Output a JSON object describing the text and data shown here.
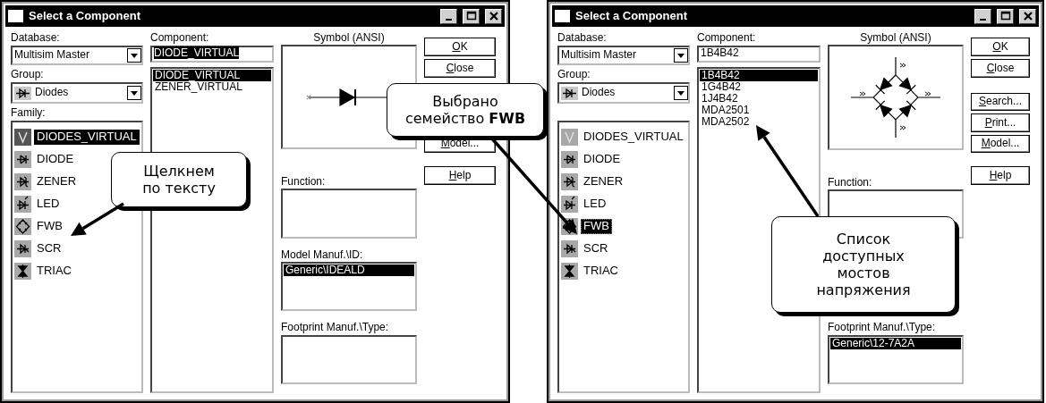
{
  "windows": [
    {
      "title": "Select a Component",
      "database": {
        "label": "Database:",
        "value": "Multisim Master"
      },
      "group": {
        "label": "Group:",
        "value": "Diodes"
      },
      "family": {
        "label": "Family:",
        "items": [
          {
            "label": "DIODES_VIRTUAL",
            "selected": true,
            "focused": false
          },
          {
            "label": "DIODE",
            "selected": false,
            "focused": false
          },
          {
            "label": "ZENER",
            "selected": false,
            "focused": false
          },
          {
            "label": "LED",
            "selected": false,
            "focused": false
          },
          {
            "label": "FWB",
            "selected": false,
            "focused": false
          },
          {
            "label": "SCR",
            "selected": false,
            "focused": false
          },
          {
            "label": "TRIAC",
            "selected": false,
            "focused": false
          }
        ]
      },
      "component": {
        "label": "Component:",
        "value": "DIODE_VIRTUAL",
        "value_highlighted": true,
        "items": [
          {
            "label": "DIODE_VIRTUAL",
            "selected": true
          },
          {
            "label": "ZENER_VIRTUAL",
            "selected": false
          }
        ]
      },
      "symbol": {
        "label": "Symbol (ANSI)",
        "kind": "diode"
      },
      "function": {
        "label": "Function:"
      },
      "model_manuf": {
        "label": "Model Manuf.\\ID:",
        "items": [
          {
            "label": "Generic\\IDEALD",
            "selected": true
          }
        ]
      },
      "footprint": {
        "label": "Footprint Manuf.\\Type:"
      },
      "button_groups": [
        [
          {
            "label": "OK"
          },
          {
            "label": "Close"
          }
        ],
        [
          {
            "label": "Model..."
          }
        ],
        [
          {
            "label": "Help"
          }
        ]
      ]
    },
    {
      "title": "Select a Component",
      "database": {
        "label": "Database:",
        "value": "Multisim Master"
      },
      "group": {
        "label": "Group:",
        "value": "Diodes"
      },
      "family": {
        "items": [
          {
            "label": "DIODES_VIRTUAL",
            "selected": false,
            "focused": false
          },
          {
            "label": "DIODE",
            "selected": false,
            "focused": false
          },
          {
            "label": "ZENER",
            "selected": false,
            "focused": false
          },
          {
            "label": "LED",
            "selected": false,
            "focused": false
          },
          {
            "label": "FWB",
            "selected": true,
            "focused": true
          },
          {
            "label": "SCR",
            "selected": false,
            "focused": false
          },
          {
            "label": "TRIAC",
            "selected": false,
            "focused": false
          }
        ]
      },
      "component": {
        "label": "Component:",
        "value": "1B4B42",
        "value_highlighted": false,
        "items": [
          {
            "label": "1B4B42",
            "selected": true
          },
          {
            "label": "1G4B42",
            "selected": false
          },
          {
            "label": "1J4B42",
            "selected": false
          },
          {
            "label": "MDA2501",
            "selected": false
          },
          {
            "label": "MDA2502",
            "selected": false
          }
        ]
      },
      "symbol": {
        "label": "Symbol (ANSI)",
        "kind": "bridge"
      },
      "function": {
        "label": "Function:"
      },
      "footprint": {
        "label": "Footprint Manuf.\\Type:",
        "items": [
          {
            "label": "Generic\\12-7A2A",
            "selected": true
          }
        ]
      },
      "button_groups": [
        [
          {
            "label": "OK"
          },
          {
            "label": "Close"
          }
        ],
        [
          {
            "label": "Search..."
          },
          {
            "label": "Print..."
          },
          {
            "label": "Model..."
          }
        ],
        [
          {
            "label": "Help"
          }
        ]
      ]
    }
  ],
  "callouts": [
    {
      "text": "Щелкнем\nпо тексту"
    },
    {
      "text": "Выбрано\nсемейство **FWB**"
    },
    {
      "text": "Список\nдоступных\nмостов\nнапряжения"
    }
  ]
}
